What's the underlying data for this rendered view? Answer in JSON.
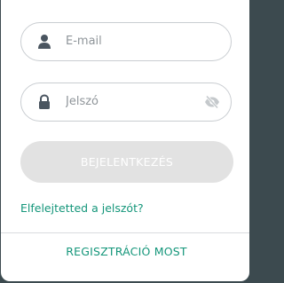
{
  "login_form": {
    "email": {
      "placeholder": "E-mail",
      "value": "",
      "icon": "user-icon"
    },
    "password": {
      "placeholder": "Jelszó",
      "value": "",
      "icon": "lock-icon",
      "toggle_icon": "eye-slash-icon"
    },
    "submit_label": "BEJELENTKEZÉS",
    "forgot_link": "Elfelejtetted a jelszót?",
    "register_link": "REGISZTRÁCIÓ MOST"
  },
  "colors": {
    "accent": "#14967a",
    "icon": "#4a5560",
    "button_disabled": "#e2e2e2",
    "field_border": "#c9cdd1"
  }
}
